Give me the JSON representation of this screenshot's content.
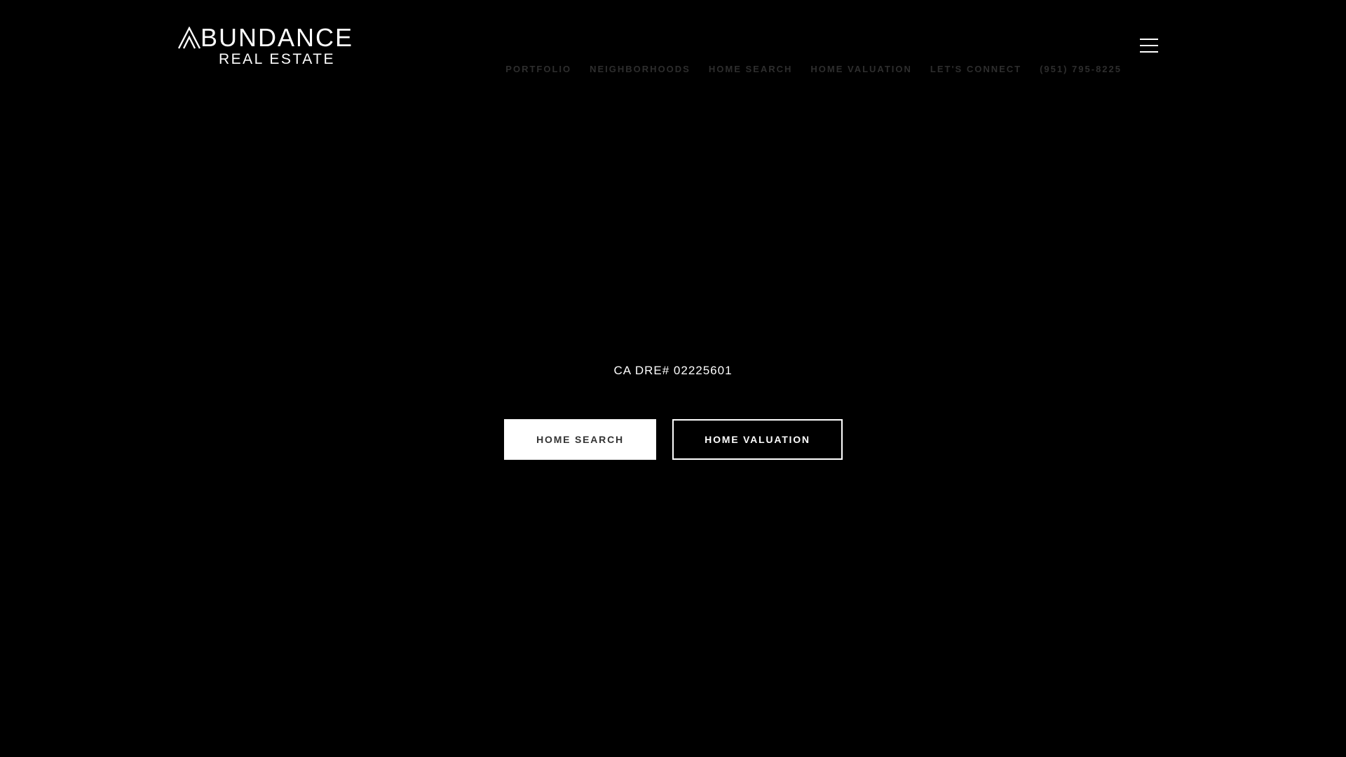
{
  "header": {
    "logo": {
      "icon": "abundance-a-mark",
      "line1": "BUNDANCE",
      "line2": "REAL ESTATE"
    },
    "menu_icon": "hamburger-menu-icon",
    "nav": [
      {
        "label": "PORTFOLIO"
      },
      {
        "label": "NEIGHBORHOODS"
      },
      {
        "label": "HOME SEARCH"
      },
      {
        "label": "HOME VALUATION"
      },
      {
        "label": "LET'S CONNECT"
      },
      {
        "label": "(951) 795-8225"
      }
    ]
  },
  "hero": {
    "license": "CA DRE# 02225601",
    "buttons": {
      "home_search": "HOME SEARCH",
      "home_valuation": "HOME VALUATION"
    }
  },
  "colors": {
    "background": "#000000",
    "text": "#ffffff",
    "nav_text": "#2e2e2e",
    "button_solid_text": "#333333"
  }
}
